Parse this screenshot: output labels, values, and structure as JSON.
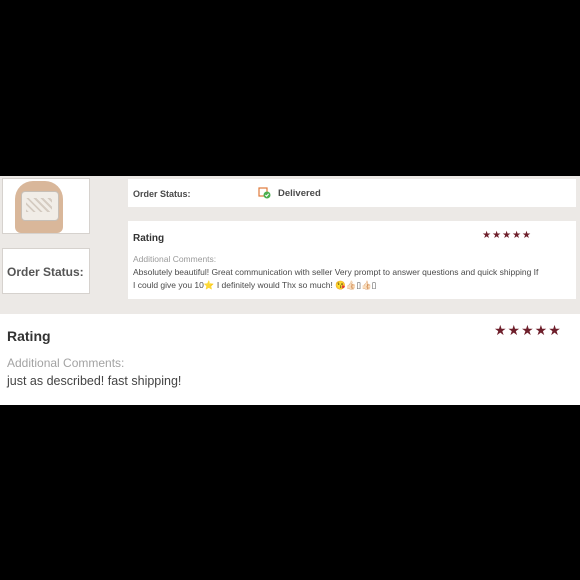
{
  "small_card": {
    "order_status_label": "Order Status:",
    "status_value": "Delivered",
    "status_icon": "box-check-icon",
    "rating_title": "Rating",
    "stars": "★★★★★",
    "additional_label": "Additional Comments:",
    "comment": "Absolutely beautiful! Great communication with seller Very prompt to answer questions and quick shipping If I could give you 10⭐ I definitely would Thx so much! 😘👍🏻▯👍🏻▯"
  },
  "large_card": {
    "order_status_label": "Order Status:",
    "rating_title": "Rating",
    "stars": "★★★★★",
    "additional_label": "Additional Comments:",
    "comment": "just as described! fast shipping!"
  },
  "colors": {
    "star": "#6e1f2b",
    "status_ok": "#4caf50",
    "panel_bg": "#ece9e6"
  }
}
